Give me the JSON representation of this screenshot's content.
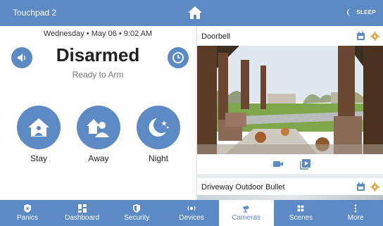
{
  "header": {
    "title": "Touchpad 2",
    "sleep_label": "SLEEP"
  },
  "panel": {
    "day": "Wednesday",
    "date": "May 06",
    "time": "9:02 AM",
    "status": "Disarmed",
    "substatus": "Ready to Arm",
    "arm_buttons": [
      {
        "label": "Stay"
      },
      {
        "label": "Away"
      },
      {
        "label": "Night"
      }
    ]
  },
  "cameras": [
    {
      "name": "Doorbell"
    },
    {
      "name": "Driveway Outdoor Bullet"
    }
  ],
  "nav": {
    "items": [
      {
        "label": "Panics",
        "icon": "shield-star-icon"
      },
      {
        "label": "Dashboard",
        "icon": "dashboard-icon"
      },
      {
        "label": "Security",
        "icon": "shield-icon"
      },
      {
        "label": "Devices",
        "icon": "devices-icon"
      },
      {
        "label": "Cameras",
        "icon": "camera-icon"
      },
      {
        "label": "Scenes",
        "icon": "scenes-icon"
      },
      {
        "label": "More",
        "icon": "more-vertical-icon"
      }
    ],
    "active": "Cameras"
  },
  "colors": {
    "accent": "#5b8ac4",
    "gear": "#e8a23c",
    "background": "#e9ecef"
  }
}
